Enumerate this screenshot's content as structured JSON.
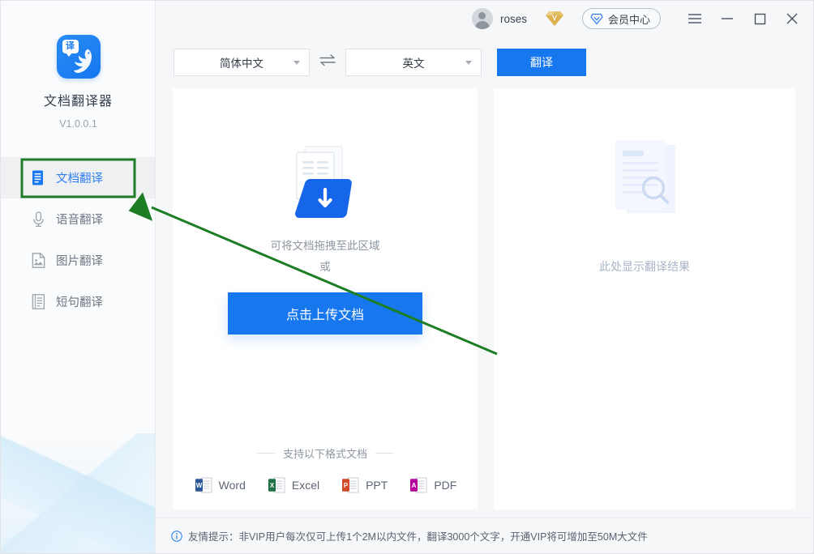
{
  "app": {
    "title": "文档翻译器",
    "version": "V1.0.0.1",
    "logo_letter": "译",
    "logo_color": "#1677ef"
  },
  "titlebar": {
    "username": "roses",
    "avatar_icon": "user-avatar-icon",
    "vip_badge_icon": "gold-diamond-vip-badge",
    "vip_badge_letter": "V",
    "vip_center_label": "会员中心",
    "vip_center_icon": "blue-diamond-icon",
    "menu_icon": "hamburger-menu-icon",
    "minimize_icon": "minimize-icon",
    "maximize_icon": "maximize-icon",
    "close_icon": "close-icon"
  },
  "sidebar": {
    "items": [
      {
        "label": "文档翻译",
        "icon": "document-icon",
        "active": true
      },
      {
        "label": "语音翻译",
        "icon": "microphone-icon",
        "active": false
      },
      {
        "label": "图片翻译",
        "icon": "image-icon",
        "active": false
      },
      {
        "label": "短句翻译",
        "icon": "text-lines-icon",
        "active": false
      }
    ]
  },
  "toolbar": {
    "source_lang": "简体中文",
    "target_lang": "英文",
    "swap_icon": "swap-arrows-icon",
    "translate_label": "翻译",
    "translate_color": "#1677ef"
  },
  "upload": {
    "illustration_icon": "document-download-icon",
    "drop_hint": "可将文档拖拽至此区域",
    "or_text": "或",
    "button_label": "点击上传文档",
    "formats_title": "支持以下格式文档",
    "formats": [
      {
        "label": "Word",
        "letter": "W",
        "color": "#2a5699"
      },
      {
        "label": "Excel",
        "letter": "X",
        "color": "#1e7145"
      },
      {
        "label": "PPT",
        "letter": "P",
        "color": "#d24726"
      },
      {
        "label": "PDF",
        "letter": "A",
        "color": "#b5009d"
      }
    ]
  },
  "result": {
    "placeholder_icon": "document-search-icon",
    "placeholder_text": "此处显示翻译结果"
  },
  "footer": {
    "info_icon": "info-circle-icon",
    "text": "友情提示：非VIP用户每次仅可上传1个2M以内文件，翻译3000个文字，开通VIP将可增加至50M大文件"
  },
  "annotation": {
    "arrow_color": "#1d7d24",
    "highlight_color": "#1d7d24",
    "target": "sidebar-item-document-translate"
  }
}
